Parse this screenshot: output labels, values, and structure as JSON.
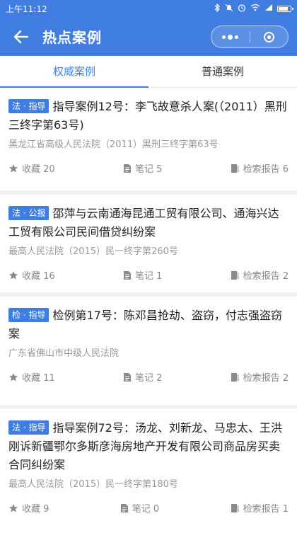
{
  "status": {
    "time": "上午11:12"
  },
  "nav": {
    "title": "热点案例"
  },
  "tabs": [
    {
      "label": "权威案例"
    },
    {
      "label": "普通案例"
    }
  ],
  "cases": [
    {
      "badge": "法 · 指导",
      "title": "指导案例12号：李飞故意杀人案(（2011）黑刑三终字第63号)",
      "court": "黑龙江省高级人民法院（2011）黑刑三终字第63号",
      "favorites": "收藏 20",
      "notes": "笔记 5",
      "reports": "检索报告 6"
    },
    {
      "badge": "法 · 公报",
      "title": "邵萍与云南通海昆通工贸有限公司、通海兴达工贸有限公司民间借贷纠纷案",
      "court": "最高人民法院（2015）民一终字第260号",
      "favorites": "收藏 16",
      "notes": "笔记 1",
      "reports": "检索报告 2"
    },
    {
      "badge": "检 · 指导",
      "title": "检例第17号：陈邓昌抢劫、盗窃，付志强盗窃案",
      "court": "广东省佛山市中级人民法院",
      "favorites": "收藏 11",
      "notes": "笔记 2",
      "reports": "检索报告 2"
    },
    {
      "badge": "法 · 指导",
      "title": "指导案例72号：汤龙、刘新龙、马忠太、王洪刚诉新疆鄂尔多斯彦海房地产开发有限公司商品房买卖合同纠纷案",
      "court": "最高人民法院（2015）民一终字第180号",
      "favorites": "收藏 9",
      "notes": "笔记 0",
      "reports": "检索报告 1"
    }
  ],
  "colors": {
    "primary": "#3f7de0",
    "muted": "#999999"
  }
}
